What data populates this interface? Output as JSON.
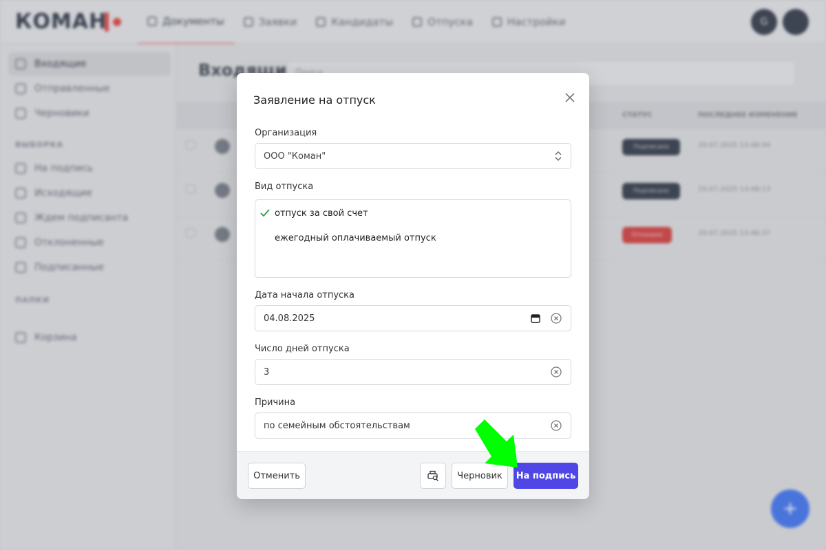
{
  "app": {
    "logo_text": "КОМАН",
    "nav": [
      {
        "label": "Документы",
        "icon": "document-icon"
      },
      {
        "label": "Заявки",
        "icon": "inbox-icon"
      },
      {
        "label": "Кандидаты",
        "icon": "person-icon"
      },
      {
        "label": "Отпуска",
        "icon": "trophy-icon"
      },
      {
        "label": "Настройки",
        "icon": "settings-icon"
      }
    ],
    "avatar_initial": "G",
    "sidebar": {
      "items": [
        "Входящие",
        "Отправленные",
        "Черновики"
      ],
      "section_filters": "ВЫБОРКА",
      "filters": [
        "На подпись",
        "Исходящие",
        "Ждем подписанта",
        "Отклоненные",
        "Подписанные"
      ],
      "section_folders": "ПАПКИ",
      "trash": "Корзина"
    },
    "main": {
      "title": "Входящие",
      "search_placeholder": "Поиск",
      "col_status": "СТАТУС",
      "col_changed": "ПОСЛЕДНЕЕ ИЗМЕНЕНИЕ",
      "rows": [
        {
          "status": "Подписано",
          "date": "29.07.2025 13:48:44"
        },
        {
          "status": "Подписано",
          "date": "29.07.2025 13:48:13"
        },
        {
          "status": "Отказано",
          "date": "29.07.2025 13:46:37"
        }
      ]
    }
  },
  "modal": {
    "title": "Заявление на отпуск",
    "organization": {
      "label": "Организация",
      "value": "ООО \"Коман\""
    },
    "vacation_type": {
      "label": "Вид отпуска",
      "options": [
        {
          "text": "отпуск за свой счет",
          "selected": true
        },
        {
          "text": "ежегодный оплачиваемый отпуск",
          "selected": false
        }
      ]
    },
    "start_date": {
      "label": "Дата начала отпуска",
      "value": "04.08.2025"
    },
    "days": {
      "label": "Число дней отпуска",
      "value": "3"
    },
    "reason": {
      "label": "Причина",
      "value": "по семейным обстоятельствам"
    },
    "buttons": {
      "cancel": "Отменить",
      "draft": "Черновик",
      "submit": "На подпись"
    }
  },
  "colors": {
    "primary": "#4f46e5",
    "check": "#22a04a",
    "arrow": "#00ff00"
  }
}
